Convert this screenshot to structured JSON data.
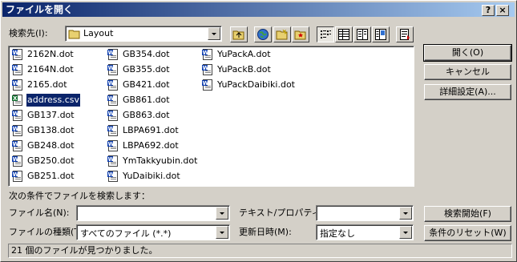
{
  "title": "ファイルを開く",
  "title_buttons": {
    "help": "?",
    "close": "×"
  },
  "look_in": {
    "label": "検索先(I):",
    "value": "Layout"
  },
  "files_col1": [
    "2162N.dot",
    "2164N.dot",
    "2165.dot",
    "address.csv",
    "GB137.dot",
    "GB138.dot",
    "GB248.dot",
    "GB250.dot",
    "GB251.dot"
  ],
  "files_col2": [
    "GB354.dot",
    "GB355.dot",
    "GB421.dot",
    "GB861.dot",
    "GB863.dot",
    "LBPA691.dot",
    "LBPA692.dot",
    "YmTakkyubin.dot",
    "YuDaibiki.dot"
  ],
  "files_col3": [
    "YuPackA.dot",
    "YuPackB.dot",
    "YuPackDaibiki.dot"
  ],
  "selected_file": "address.csv",
  "buttons": {
    "open": "開く(O)",
    "cancel": "キャンセル",
    "advanced": "詳細設定(A)...",
    "search_start": "検索開始(F)",
    "reset": "条件のリセット(W)"
  },
  "search": {
    "heading": "次の条件でファイルを検索します：",
    "filename_label": "ファイル名(N):",
    "filename_value": "",
    "filetype_label": "ファイルの種類(T):",
    "filetype_value": "すべてのファイル (*.*)",
    "text_label": "テキスト/プロパティ(X):",
    "text_value": "",
    "date_label": "更新日時(M):",
    "date_value": "指定なし"
  },
  "status": "21 個のファイルが見つかりました。",
  "colors": {
    "title_start": "#0a246a",
    "title_end": "#a6caf0",
    "selection": "#0a246a",
    "face": "#d4d0c8"
  }
}
